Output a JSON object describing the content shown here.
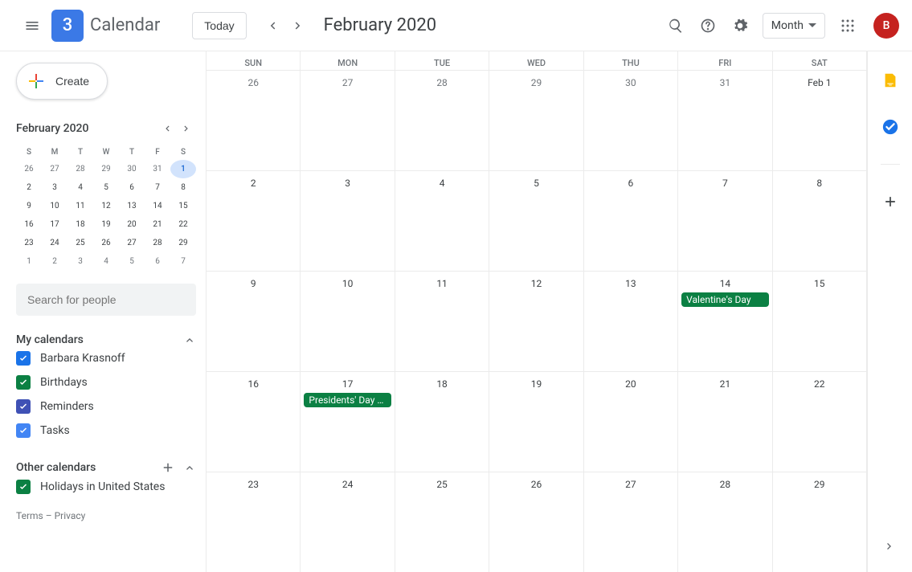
{
  "header": {
    "logo_day": "3",
    "app_title": "Calendar",
    "today_label": "Today",
    "month_title": "February 2020",
    "view_label": "Month",
    "avatar_initial": "B"
  },
  "sidebar": {
    "create_label": "Create",
    "mini_month": "February 2020",
    "dows": [
      "S",
      "M",
      "T",
      "W",
      "T",
      "F",
      "S"
    ],
    "mini_weeks": [
      [
        {
          "d": "26",
          "dim": true
        },
        {
          "d": "27",
          "dim": true
        },
        {
          "d": "28",
          "dim": true
        },
        {
          "d": "29",
          "dim": true
        },
        {
          "d": "30",
          "dim": true
        },
        {
          "d": "31",
          "dim": true
        },
        {
          "d": "1",
          "sel": true
        }
      ],
      [
        {
          "d": "2"
        },
        {
          "d": "3"
        },
        {
          "d": "4"
        },
        {
          "d": "5"
        },
        {
          "d": "6"
        },
        {
          "d": "7"
        },
        {
          "d": "8"
        }
      ],
      [
        {
          "d": "9"
        },
        {
          "d": "10"
        },
        {
          "d": "11"
        },
        {
          "d": "12"
        },
        {
          "d": "13"
        },
        {
          "d": "14"
        },
        {
          "d": "15"
        }
      ],
      [
        {
          "d": "16"
        },
        {
          "d": "17"
        },
        {
          "d": "18"
        },
        {
          "d": "19"
        },
        {
          "d": "20"
        },
        {
          "d": "21"
        },
        {
          "d": "22"
        }
      ],
      [
        {
          "d": "23"
        },
        {
          "d": "24"
        },
        {
          "d": "25"
        },
        {
          "d": "26"
        },
        {
          "d": "27"
        },
        {
          "d": "28"
        },
        {
          "d": "29"
        }
      ],
      [
        {
          "d": "1",
          "dim": true
        },
        {
          "d": "2",
          "dim": true
        },
        {
          "d": "3",
          "dim": true
        },
        {
          "d": "4",
          "dim": true
        },
        {
          "d": "5",
          "dim": true
        },
        {
          "d": "6",
          "dim": true
        },
        {
          "d": "7",
          "dim": true
        }
      ]
    ],
    "search_placeholder": "Search for people",
    "my_calendars_title": "My calendars",
    "my_calendars": [
      {
        "label": "Barbara Krasnoff",
        "color": "#1a73e8"
      },
      {
        "label": "Birthdays",
        "color": "#0b8043"
      },
      {
        "label": "Reminders",
        "color": "#3f51b5"
      },
      {
        "label": "Tasks",
        "color": "#4285f4"
      }
    ],
    "other_calendars_title": "Other calendars",
    "other_calendars": [
      {
        "label": "Holidays in United States",
        "color": "#0b8043"
      }
    ],
    "terms": "Terms",
    "privacy": "Privacy"
  },
  "grid": {
    "dows": [
      "SUN",
      "MON",
      "TUE",
      "WED",
      "THU",
      "FRI",
      "SAT"
    ],
    "weeks": [
      [
        {
          "n": "26",
          "dim": true
        },
        {
          "n": "27",
          "dim": true
        },
        {
          "n": "28",
          "dim": true
        },
        {
          "n": "29",
          "dim": true
        },
        {
          "n": "30",
          "dim": true
        },
        {
          "n": "31",
          "dim": true
        },
        {
          "n": "Feb 1"
        }
      ],
      [
        {
          "n": "2"
        },
        {
          "n": "3"
        },
        {
          "n": "4"
        },
        {
          "n": "5"
        },
        {
          "n": "6"
        },
        {
          "n": "7"
        },
        {
          "n": "8"
        }
      ],
      [
        {
          "n": "9"
        },
        {
          "n": "10"
        },
        {
          "n": "11"
        },
        {
          "n": "12"
        },
        {
          "n": "13"
        },
        {
          "n": "14",
          "events": [
            {
              "title": "Valentine's Day"
            }
          ]
        },
        {
          "n": "15"
        }
      ],
      [
        {
          "n": "16"
        },
        {
          "n": "17",
          "events": [
            {
              "title": "Presidents' Day (re"
            }
          ]
        },
        {
          "n": "18"
        },
        {
          "n": "19"
        },
        {
          "n": "20"
        },
        {
          "n": "21"
        },
        {
          "n": "22"
        }
      ],
      [
        {
          "n": "23"
        },
        {
          "n": "24"
        },
        {
          "n": "25"
        },
        {
          "n": "26"
        },
        {
          "n": "27"
        },
        {
          "n": "28"
        },
        {
          "n": "29"
        }
      ]
    ]
  }
}
